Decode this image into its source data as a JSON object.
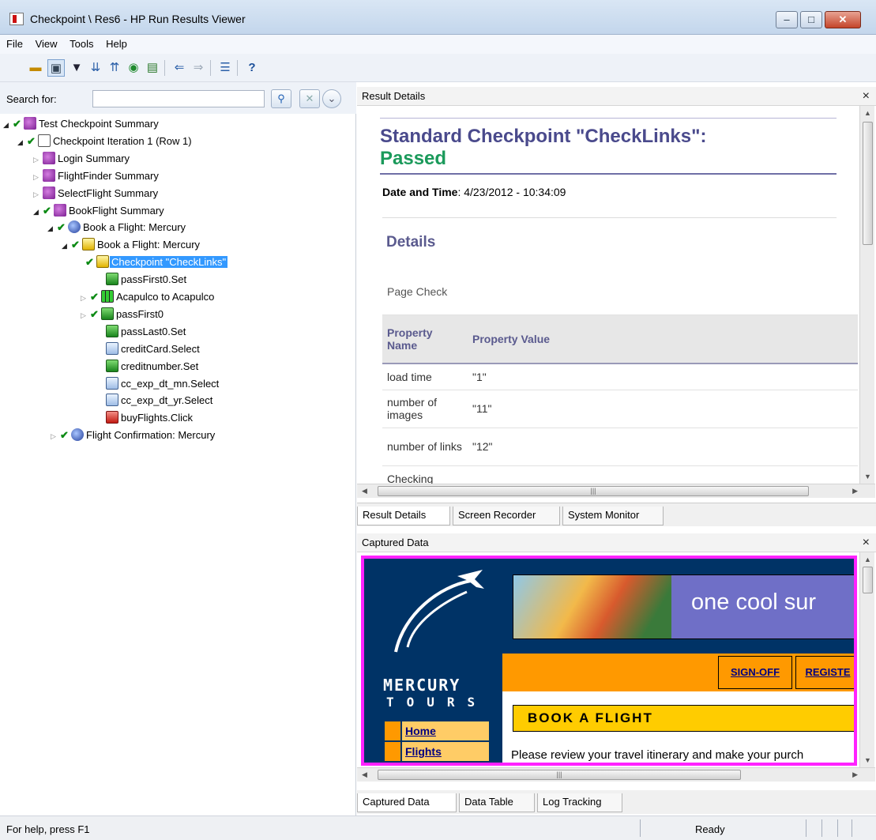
{
  "window": {
    "title": "Checkpoint \\ Res6 - HP Run Results Viewer",
    "controls": {
      "minimize": "–",
      "maximize": "□",
      "close": "✕"
    }
  },
  "menu": [
    "File",
    "View",
    "Tools",
    "Help"
  ],
  "toolbar": {
    "icons": [
      "open-icon",
      "view-toggle-icon",
      "filter-icon",
      "expand-all-icon",
      "collapse-all-icon",
      "find-icon",
      "export-icon",
      "back-icon",
      "forward-icon",
      "list-icon",
      "help-icon"
    ]
  },
  "search": {
    "label": "Search for:",
    "value": "",
    "placeholder": ""
  },
  "tree": [
    {
      "label": "Test Checkpoint Summary",
      "icon": "summary",
      "expander": "open",
      "check": true
    },
    {
      "label": "Checkpoint Iteration 1 (Row 1)",
      "icon": "iter",
      "expander": "open",
      "check": true
    },
    {
      "label": "Login Summary",
      "icon": "summary",
      "expander": "closed",
      "check": false
    },
    {
      "label": "FlightFinder Summary",
      "icon": "summary",
      "expander": "closed",
      "check": false
    },
    {
      "label": "SelectFlight Summary",
      "icon": "summary",
      "expander": "closed",
      "check": false
    },
    {
      "label": "BookFlight Summary",
      "icon": "summary",
      "expander": "open",
      "check": true
    },
    {
      "label": "Book a Flight: Mercury",
      "icon": "globe",
      "expander": "open",
      "check": true
    },
    {
      "label": "Book a Flight: Mercury",
      "icon": "page",
      "expander": "open",
      "check": true
    },
    {
      "label": "Checkpoint \"CheckLinks\"",
      "icon": "page",
      "expander": "none",
      "check": true,
      "selected": true
    },
    {
      "label": "passFirst0.Set",
      "icon": "step",
      "expander": "none",
      "check": false
    },
    {
      "label": "Acapulco to Acapulco",
      "icon": "table",
      "expander": "closed",
      "check": true
    },
    {
      "label": "passFirst0",
      "icon": "step",
      "expander": "closed",
      "check": true
    },
    {
      "label": "passLast0.Set",
      "icon": "step",
      "expander": "none",
      "check": false
    },
    {
      "label": "creditCard.Select",
      "icon": "list",
      "expander": "none",
      "check": false
    },
    {
      "label": "creditnumber.Set",
      "icon": "step",
      "expander": "none",
      "check": false
    },
    {
      "label": "cc_exp_dt_mn.Select",
      "icon": "list",
      "expander": "none",
      "check": false
    },
    {
      "label": "cc_exp_dt_yr.Select",
      "icon": "list",
      "expander": "none",
      "check": false
    },
    {
      "label": "buyFlights.Click",
      "icon": "btn",
      "expander": "none",
      "check": false
    },
    {
      "label": "Flight Confirmation: Mercury",
      "icon": "globe",
      "expander": "closed",
      "check": true
    }
  ],
  "result_details": {
    "header": "Result Details",
    "close": "×",
    "title": "Standard Checkpoint \"CheckLinks\":",
    "status": "Passed",
    "date_label": "Date and Time",
    "date_value": ": 4/23/2012 - 10:34:09",
    "details_heading": "Details",
    "table": {
      "section": "Page Check",
      "col_name": "Property Name",
      "col_value": "Property Value",
      "rows": [
        {
          "name": "load time",
          "value": "\"1\""
        },
        {
          "name": "number of images",
          "value": "\"11\""
        },
        {
          "name": "number of links",
          "value": "\"12\""
        },
        {
          "name": "Checking",
          "value": ""
        }
      ]
    },
    "tabs": [
      "Result Details",
      "Screen Recorder",
      "System Monitor"
    ]
  },
  "captured_data": {
    "header": "Captured Data",
    "close": "×",
    "site": {
      "logo_text": "MERCURY",
      "logo_sub": "TOURS",
      "slogan": "one cool sur",
      "links": [
        "SIGN-OFF",
        "REGISTE"
      ],
      "book_heading": "BOOK A FLIGHT",
      "nav": [
        "Home",
        "Flights"
      ],
      "paragraph": "Please review your travel itinerary and make your purch"
    },
    "tabs": [
      "Captured Data",
      "Data Table",
      "Log Tracking"
    ]
  },
  "statusbar": {
    "help": "For help, press F1",
    "state": "Ready"
  }
}
